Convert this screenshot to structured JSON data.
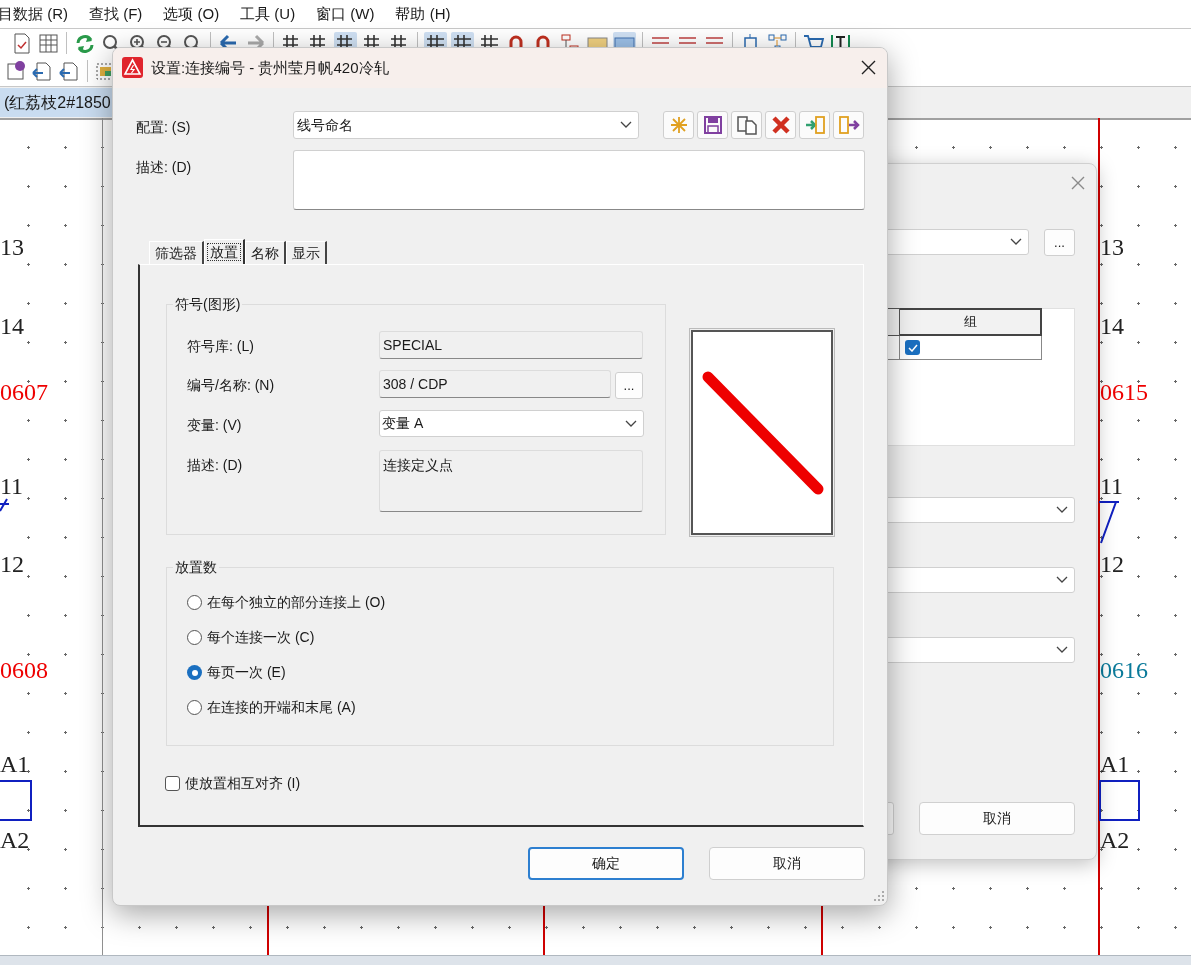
{
  "menu": [
    "目数据 (R)",
    "查找 (F)",
    "选项 (O)",
    "工具 (U)",
    "窗口 (W)",
    "帮助 (H)"
  ],
  "document_tab": {
    "label": "(红荔枝2#1850"
  },
  "schematic": {
    "left_column": [
      {
        "text": "13",
        "color": "#222222"
      },
      {
        "text": "14",
        "color": "#222222"
      },
      {
        "text": "0607",
        "color": "#ee0000"
      },
      {
        "text": "11",
        "color": "#222222"
      },
      {
        "text": "12",
        "color": "#222222"
      },
      {
        "text": "0608",
        "color": "#ee0000"
      },
      {
        "text": "A1",
        "color": "#222222"
      },
      {
        "text": "A2",
        "color": "#222222"
      }
    ],
    "right_column": [
      {
        "text": "13",
        "color": "#222222"
      },
      {
        "text": "14",
        "color": "#222222"
      },
      {
        "text": "0615",
        "color": "#ee0000"
      },
      {
        "text": "11",
        "color": "#222222"
      },
      {
        "text": "12",
        "color": "#222222"
      },
      {
        "text": "0616",
        "color": "#0a7a9a"
      },
      {
        "text": "A1",
        "color": "#222222"
      },
      {
        "text": "A2",
        "color": "#222222"
      }
    ]
  },
  "background_dialog": {
    "browse_button": "...",
    "table": {
      "columns": [
        "组"
      ],
      "rows": [
        {
          "checked": true
        }
      ]
    },
    "cancel_button": "取消"
  },
  "dialog": {
    "title": "设置:连接编号 - 贵州莹月帆420冷轧",
    "config": {
      "label": "配置: (S)",
      "value": "线号命名"
    },
    "description": {
      "label": "描述: (D)"
    },
    "tabs": [
      {
        "label": "筛选器",
        "selected": false
      },
      {
        "label": "放置",
        "selected": true
      },
      {
        "label": "名称",
        "selected": false
      },
      {
        "label": "显示",
        "selected": false
      }
    ],
    "symbol_group": {
      "title": "符号(图形)",
      "fields": [
        {
          "kind": "text",
          "label": "符号库: (L)",
          "value": "SPECIAL"
        },
        {
          "kind": "browse",
          "label": "编号/名称: (N)",
          "value": "308 / CDP",
          "button": "..."
        },
        {
          "kind": "dropdown",
          "label": "变量: (V)",
          "value": "变量 A"
        },
        {
          "kind": "textarea",
          "label": "描述: (D)",
          "value": "连接定义点"
        }
      ]
    },
    "placement_group": {
      "title": "放置数",
      "options": [
        {
          "label": "在每个独立的部分连接上 (O)",
          "selected": false
        },
        {
          "label": "每个连接一次 (C)",
          "selected": false
        },
        {
          "label": "每页一次 (E)",
          "selected": true
        },
        {
          "label": "在连接的开端和末尾 (A)",
          "selected": false
        }
      ]
    },
    "align_checkbox": {
      "label": "使放置相互对齐 (I)",
      "checked": false
    },
    "buttons": [
      {
        "label": "确定",
        "default": true
      },
      {
        "label": "取消",
        "default": false
      }
    ]
  }
}
